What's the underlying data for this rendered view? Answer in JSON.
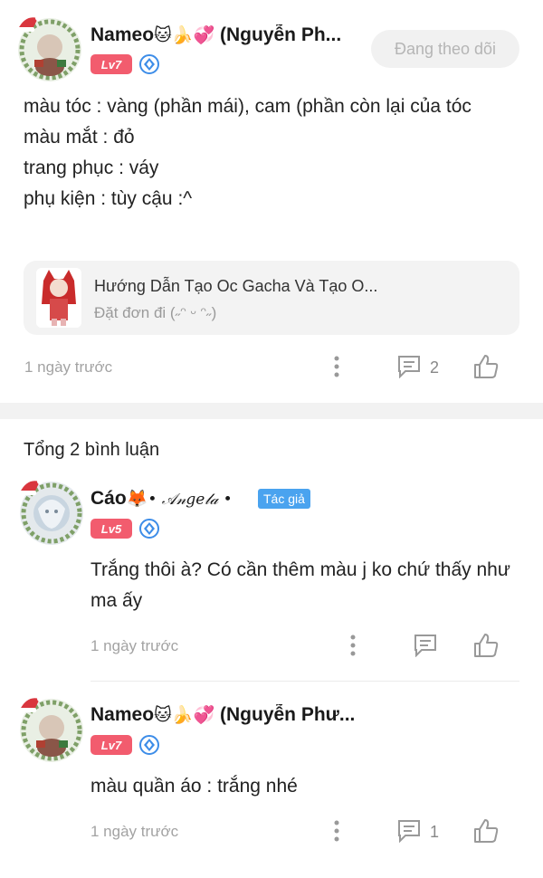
{
  "post": {
    "author": {
      "name": "Nameo",
      "name_emojis": "🐱🍌💞",
      "name_suffix": "(Nguyễn Ph...",
      "level": "Lv7"
    },
    "follow_label": "Đang theo dõi",
    "body_lines": [
      "màu tóc : vàng (phần mái), cam (phần còn lại của tóc",
      "màu mắt : đỏ",
      "trang phục : váy",
      "phụ kiện : tùy cậu :^"
    ],
    "link": {
      "title": "Hướng Dẫn Tạo Oc Gacha Và Tạo O...",
      "subtitle": "Đặt đơn đi (˶ᵔ ᵕ ᵔ˶)"
    },
    "time": "1 ngày trước",
    "comment_count": "2"
  },
  "comments_section": {
    "total_label": "Tổng 2 bình luận"
  },
  "comments": [
    {
      "name": "Cáo",
      "name_emojis": "🦊",
      "name_suffix": "• 𝒜𝓃𝑔𝑒𝓁𝒶 •",
      "level": "Lv5",
      "author_tag": "Tác giả",
      "text": "Trắng thôi à? Có cần thêm màu j ko chứ thấy như ma ấy",
      "time": "1 ngày trước"
    },
    {
      "name": "Nameo",
      "name_emojis": "🐱🍌💞",
      "name_suffix": "(Nguyễn Phư...",
      "level": "Lv7",
      "text": "màu quần áo : trắng nhé",
      "time": "1 ngày trước",
      "reply_count": "1"
    }
  ],
  "colors": {
    "level_badge": "#f25c6e",
    "author_tag": "#4aa3ef",
    "gem": "#3d8de8"
  }
}
